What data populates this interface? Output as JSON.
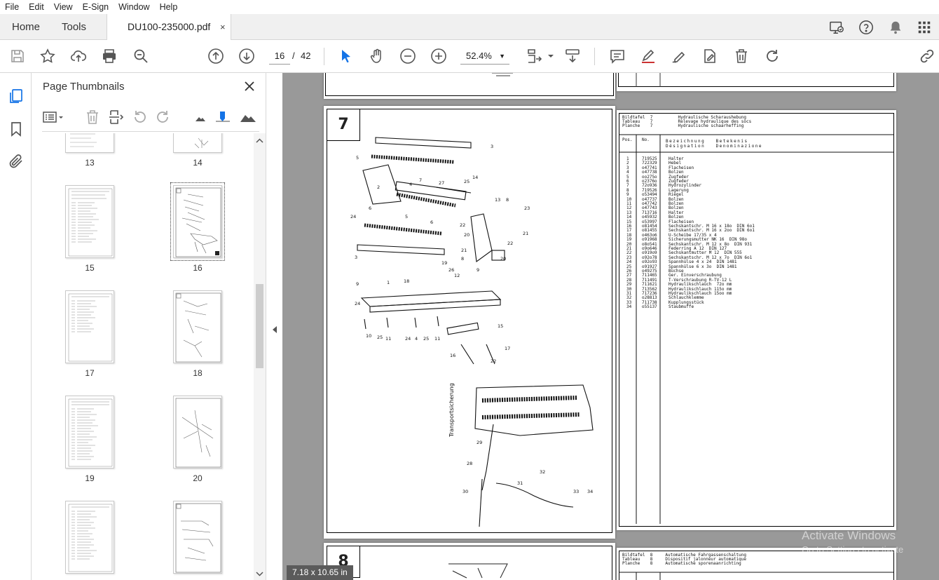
{
  "menu": [
    "File",
    "Edit",
    "View",
    "E-Sign",
    "Window",
    "Help"
  ],
  "tabs": {
    "home": "Home",
    "tools": "Tools",
    "document": "DU100-235000.pdf",
    "close_glyph": "×"
  },
  "toolbar": {
    "current_page": "16",
    "page_separator": "/",
    "total_pages": "42",
    "zoom": "52.4%"
  },
  "thumbnails": {
    "title": "Page Thumbnails",
    "pages": [
      "13",
      "14",
      "15",
      "16",
      "17",
      "18",
      "19",
      "20"
    ],
    "selected": "16"
  },
  "document": {
    "page_size": "7.18 x 10.65 in",
    "diagram_number": "7",
    "next_diagram_number": "8",
    "parts_header": [
      "Bildtafel  7          Hydraulische Scharaushebung",
      "Tableau    7          Relevage hydraulique des socs",
      "Planche    7          Hydraulische schaarheffing"
    ],
    "col_headers": [
      "Pos.",
      "No.",
      "Bezeichnung   Betekenis",
      "Désignation   Denominazione"
    ],
    "parts": [
      [
        "1",
        "719525",
        "Halter"
      ],
      [
        "2",
        "722329",
        "Hebel"
      ],
      [
        "3",
        "o47741",
        "Flacheisen"
      ],
      [
        "4",
        "o47738",
        "Bolzen"
      ],
      [
        "5",
        "oo275o",
        "Zugfeder"
      ],
      [
        "6",
        "o2376o",
        "Zugfeder"
      ],
      [
        "7",
        "72o936",
        "Hydrozylinder"
      ],
      [
        "8",
        "719526",
        "Lagerung"
      ],
      [
        "9",
        "o53494",
        "Riegel"
      ],
      [
        "10",
        "o47737",
        "Bolzen"
      ],
      [
        "11",
        "o47742",
        "Bolzen"
      ],
      [
        "12",
        "o47743",
        "Bolzen"
      ],
      [
        "13",
        "713716",
        "Halter"
      ],
      [
        "14",
        "o45932",
        "Bolzen"
      ],
      [
        "15",
        "o53997",
        "Flacheisen"
      ],
      [
        "16",
        "o81454",
        "Sechskantschr. M 16 x 18o  DIN 6o1"
      ],
      [
        "17",
        "o81455",
        "Sechskantschr. M 16 x 2oo  DIN 6o1"
      ],
      [
        "18",
        "o463o6",
        "U-Scheibe 17/35 x 4"
      ],
      [
        "19",
        "o91968",
        "Sicherungsmutter NK 16  DIN 98o"
      ],
      [
        "20",
        "o8o541",
        "Sechskantschr. M 12 x 8o  DIN 931"
      ],
      [
        "21",
        "o9o646",
        "Federring A 12  DIN 127"
      ],
      [
        "22",
        "o919o9",
        "Sechskantmutter M 12  DIN 555"
      ],
      [
        "23",
        "o92o78",
        "Sechskantschr. M 12 x 7o  DIN 6o1"
      ],
      [
        "24",
        "o92o93",
        "Spannhülse 4 x 24  DIN 1481"
      ],
      [
        "25",
        "o91927",
        "Spannhülse 6 x 3o  DIN 1481"
      ],
      [
        "26",
        "o49275",
        "Büchse"
      ],
      [
        "27",
        "711465",
        "Ger. Einverschraubung"
      ],
      [
        "28",
        "711491",
        "T-Verschraubung R-TV-12 L"
      ],
      [
        "29",
        "711621",
        "Hydraulikschlauch  72o mm"
      ],
      [
        "30",
        "713562",
        "Hydraulikschlauch 115o mm"
      ],
      [
        "31",
        "717236",
        "Hydraulikschlauch 15oo mm"
      ],
      [
        "32",
        "o28813",
        "Schlauchklemme"
      ],
      [
        "33",
        "711738",
        "Kupplungsstück"
      ],
      [
        "34",
        "o55137",
        "Staubmuffe"
      ]
    ],
    "diagram_side_label": "Transportsicherung",
    "next_parts_header": [
      "Bildtafel  8     Automatische Fahrgassenschaltung",
      "Tableau    8     Dispositif jalonneur automatique",
      "Planche    8     Automatische sporenaanrichting"
    ],
    "watermark_line1": "Activate Windows",
    "watermark_line2": "Go to Settings to activate Windows."
  }
}
